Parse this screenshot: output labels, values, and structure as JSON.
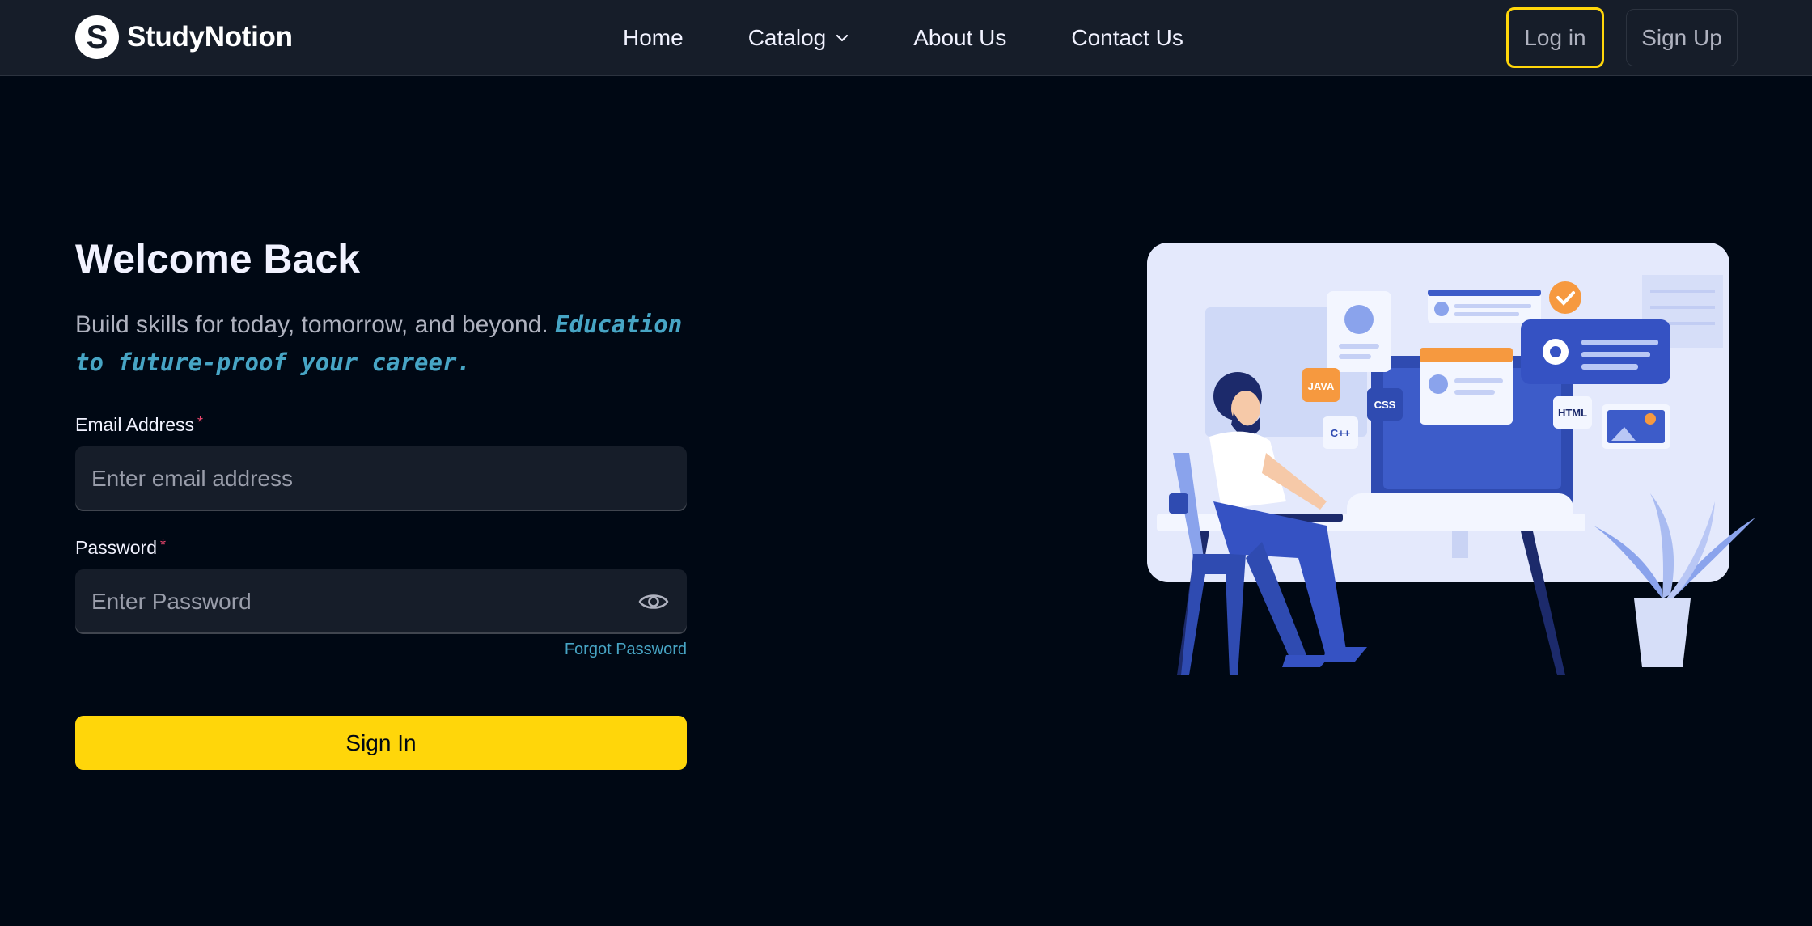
{
  "brand": {
    "logo_letter": "S",
    "name": "StudyNotion"
  },
  "nav": {
    "links": [
      "Home",
      "Catalog",
      "About Us",
      "Contact Us"
    ]
  },
  "auth": {
    "login_label": "Log in",
    "signup_label": "Sign Up"
  },
  "form": {
    "heading": "Welcome Back",
    "subtitle": "Build skills for today, tomorrow, and beyond.",
    "subtitle_accent": "Education to future-proof your career",
    "subtitle_end": ".",
    "email_label": "Email Address",
    "email_placeholder": "Enter email address",
    "password_label": "Password",
    "password_placeholder": "Enter Password",
    "required_mark": "*",
    "forgot_label": "Forgot Password",
    "submit_label": "Sign In"
  },
  "illustration": {
    "tags": [
      "JAVA",
      "CSS",
      "C++",
      "HTML"
    ]
  },
  "colors": {
    "background": "#000814",
    "navbar": "#161d29",
    "accent_yellow": "#ffd60a",
    "accent_blue": "#47a5c5",
    "required_pink": "#ef476f"
  },
  "icons": [
    "logo-s-icon",
    "chevron-down-icon",
    "eye-icon"
  ]
}
